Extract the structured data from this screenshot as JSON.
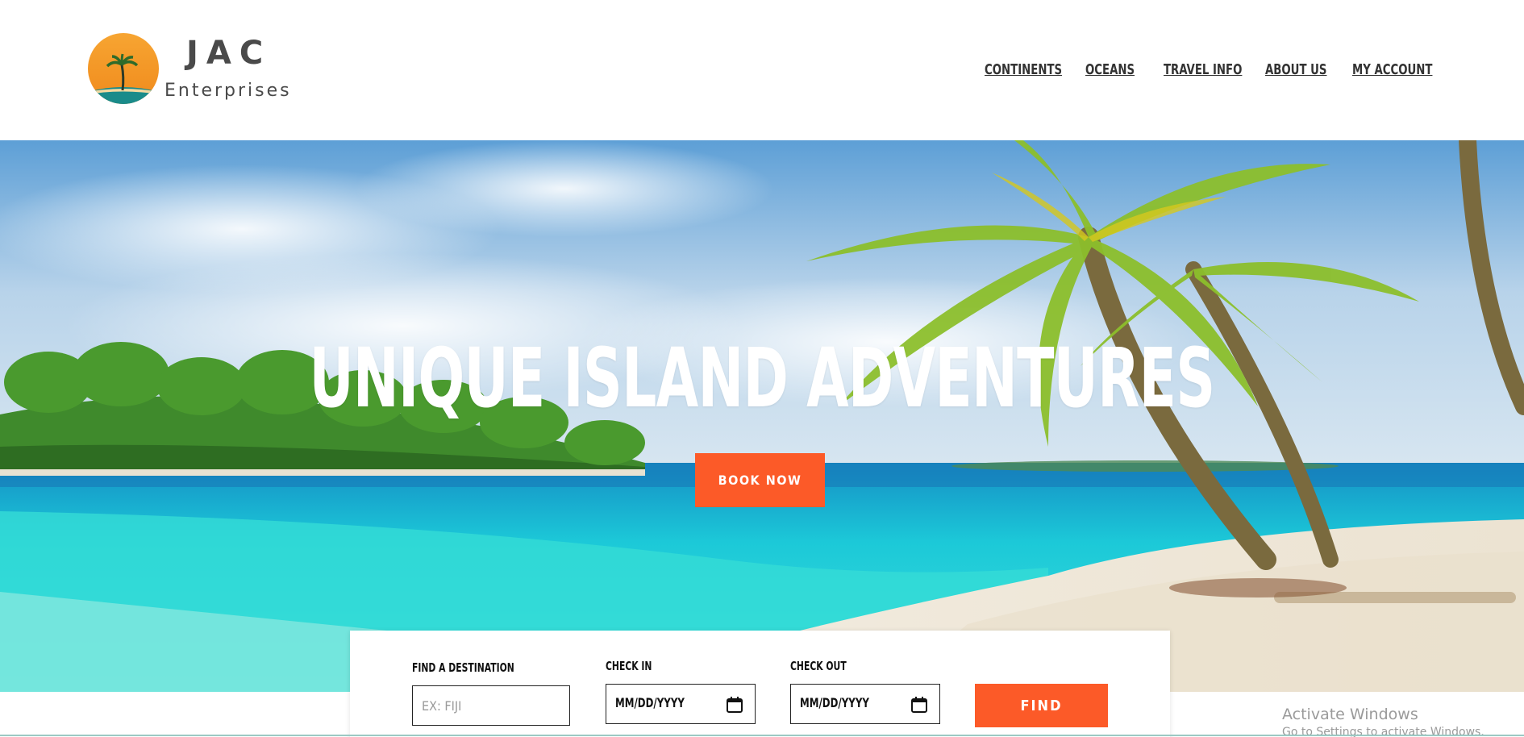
{
  "brand": {
    "name": "JAC",
    "tagline": "Enterprises"
  },
  "nav": {
    "items": [
      {
        "label": "CONTINENTS"
      },
      {
        "label": "OCEANS"
      },
      {
        "label": "TRAVEL INFO"
      },
      {
        "label": "ABOUT US"
      },
      {
        "label": "MY ACCOUNT"
      }
    ]
  },
  "hero": {
    "title": "UNIQUE ISLAND ADVENTURES",
    "cta_label": "BOOK NOW"
  },
  "booking": {
    "destination": {
      "label": "FIND A DESTINATION",
      "placeholder": "EX: FIJI",
      "value": ""
    },
    "check_in": {
      "label": "CHECK IN",
      "value": "MM/DD/YYYY"
    },
    "check_out": {
      "label": "CHECK OUT",
      "value": "MM/DD/YYYY"
    },
    "find_label": "FIND"
  },
  "watermark": {
    "title": "Activate Windows",
    "subtitle": "Go to Settings to activate Windows."
  },
  "icons": {
    "logo": "sunset-palm-logo-icon",
    "date_picker": "calendar-icon"
  },
  "colors": {
    "accent": "#fc5a28",
    "text_dark": "#333333",
    "logo_orange": "#f39221",
    "logo_teal": "#1a8b8a"
  }
}
